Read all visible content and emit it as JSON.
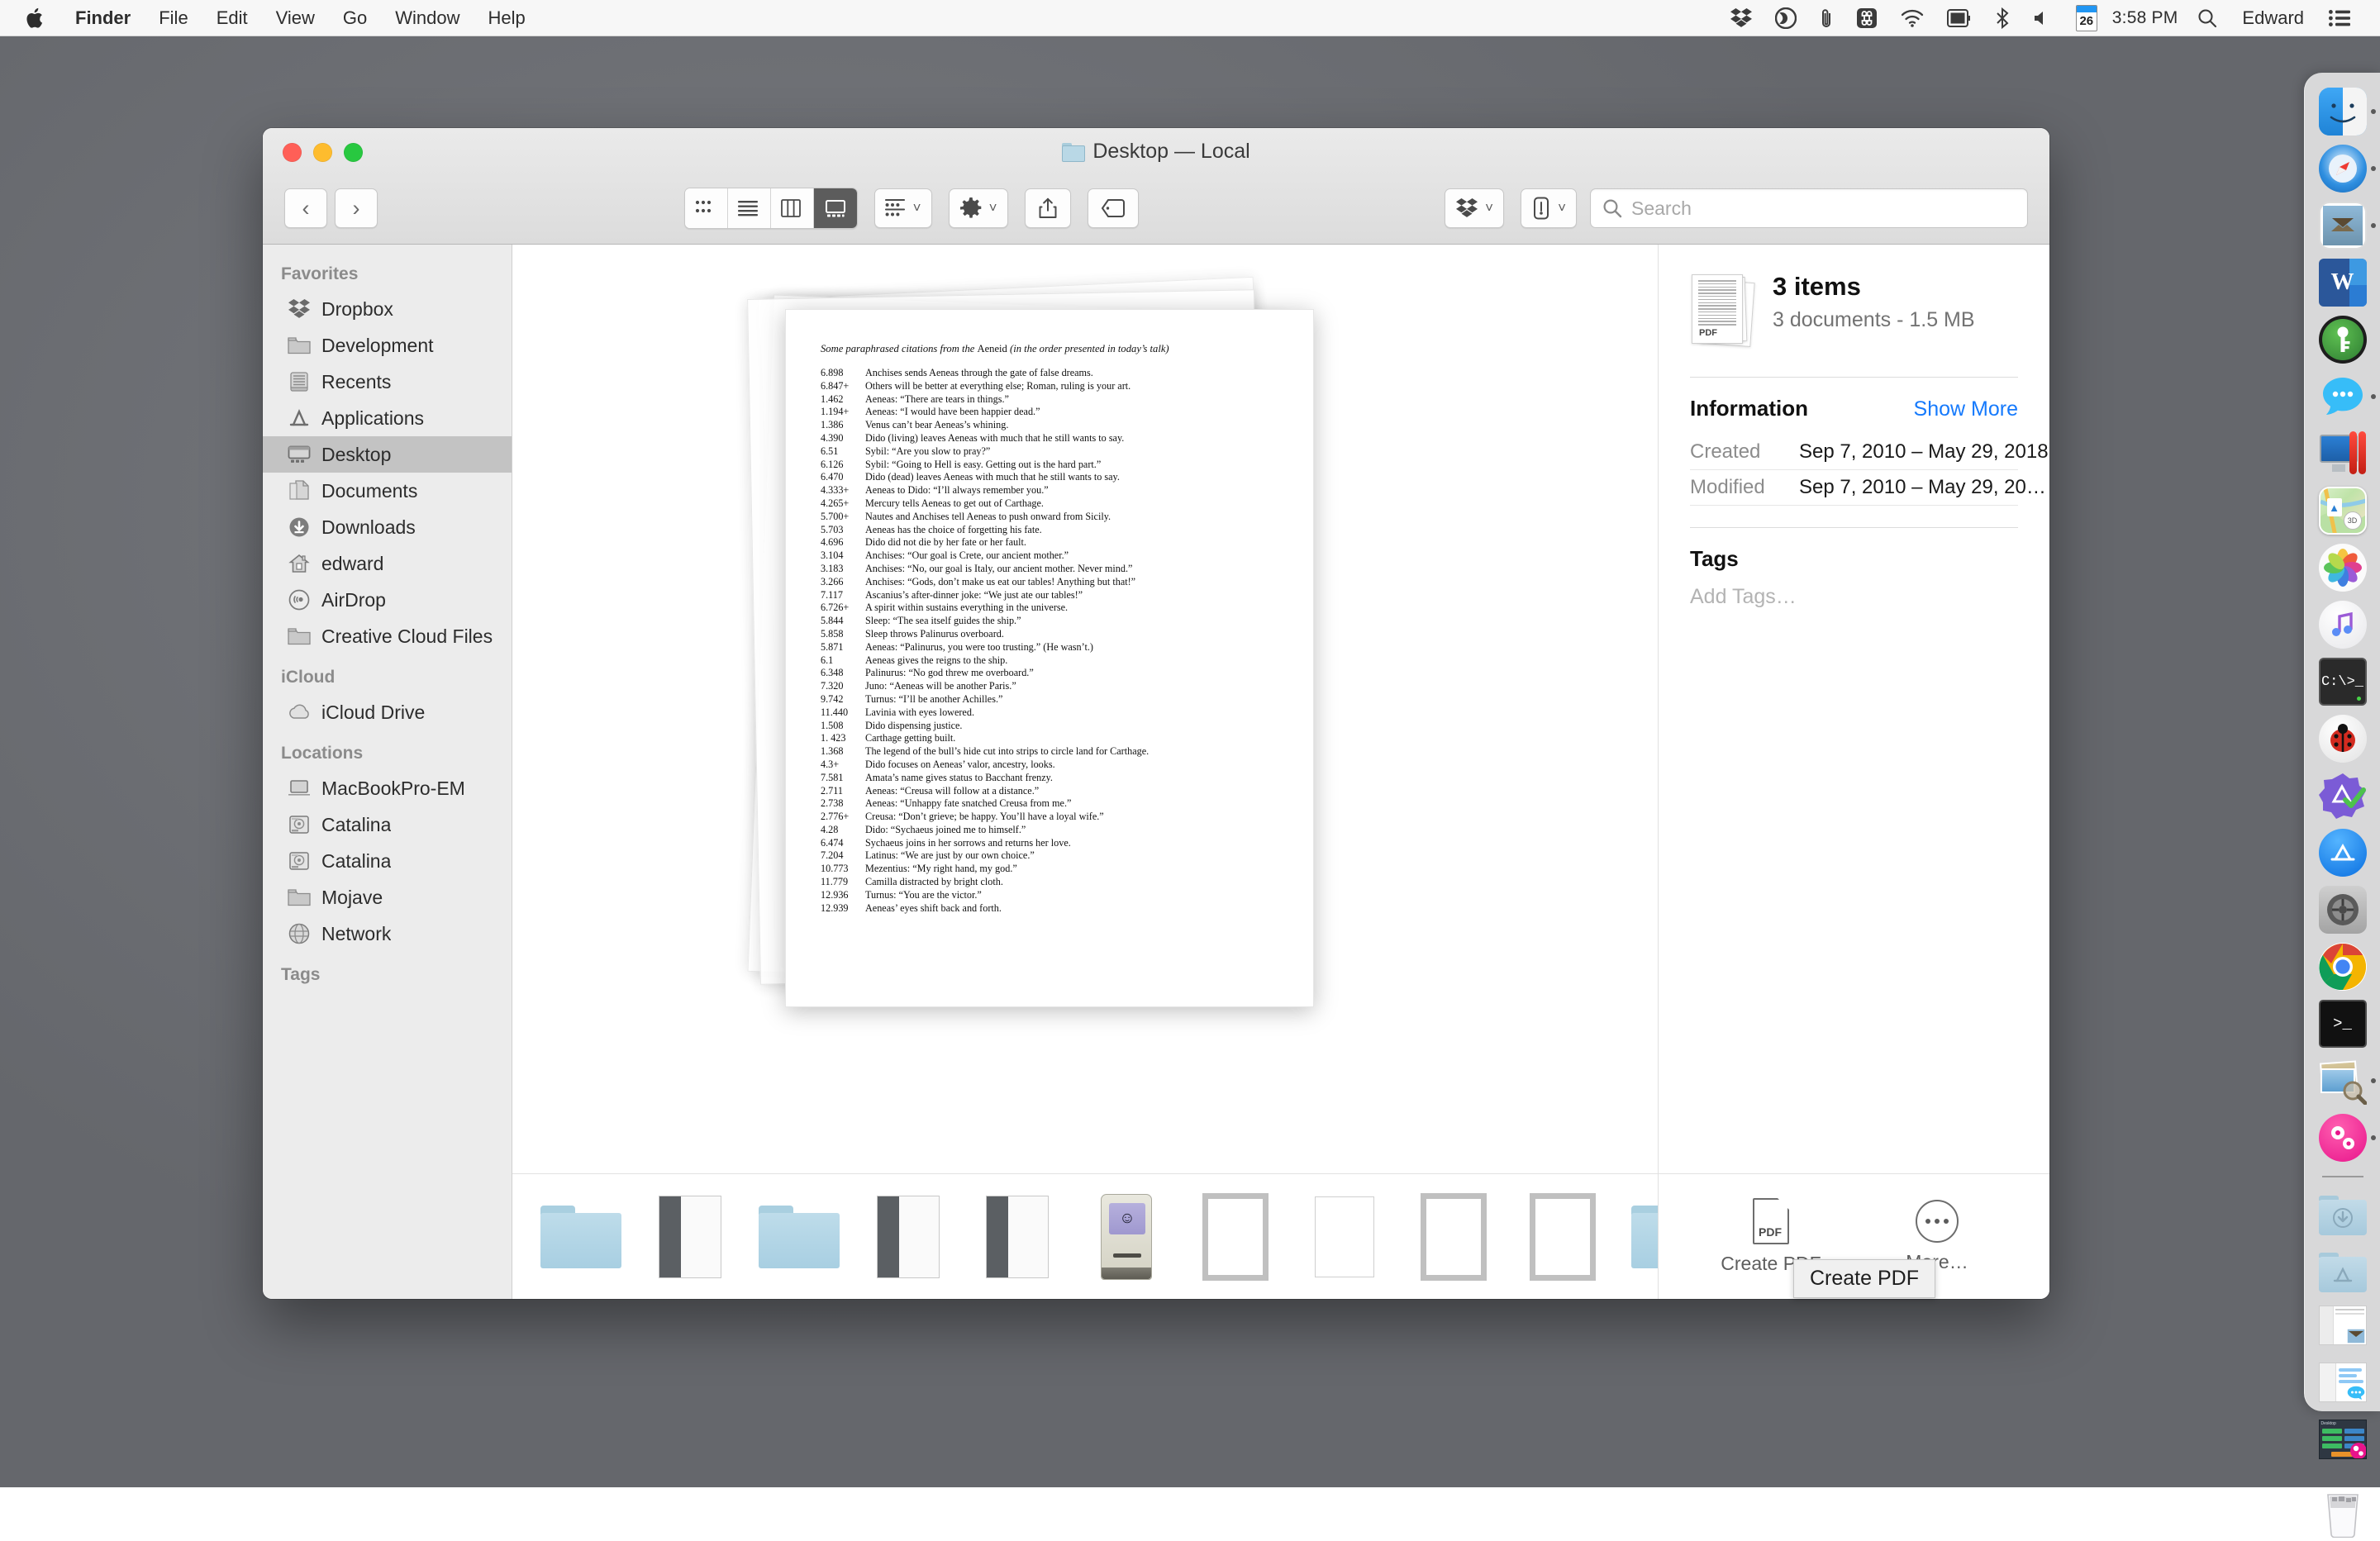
{
  "menubar": {
    "apple_icon": "apple-logo-icon",
    "items": [
      {
        "label": "Finder",
        "bold": true
      },
      {
        "label": "File",
        "bold": false
      },
      {
        "label": "Edit",
        "bold": false
      },
      {
        "label": "View",
        "bold": false
      },
      {
        "label": "Go",
        "bold": false
      },
      {
        "label": "Window",
        "bold": false
      },
      {
        "label": "Help",
        "bold": false
      }
    ],
    "status_icons": [
      "dropbox-icon",
      "creative-cloud-icon",
      "paperclip-icon",
      "command-key-icon",
      "wifi-icon",
      "display-icon",
      "bluetooth-icon",
      "volume-icon"
    ],
    "calendar_day": "26",
    "time": "3:58 PM",
    "search_icon": "spotlight-search-icon",
    "user": "Edward",
    "control_center_icon": "control-center-icon"
  },
  "window": {
    "title": "Desktop — Local",
    "title_icon": "folder-icon",
    "traffic_lights": [
      "close-button",
      "minimize-button",
      "zoom-button"
    ],
    "toolbar": {
      "back_label": "‹",
      "forward_label": "›",
      "view_modes": [
        "icon-view",
        "list-view",
        "column-view",
        "gallery-view"
      ],
      "active_view": "gallery-view",
      "group_by_label": "group-by-button",
      "action_label": "action-gear-button",
      "share_label": "share-button",
      "tags_label": "tags-button",
      "dropbox_label": "dropbox-button",
      "airdrop_label": "airdrop-button"
    },
    "search": {
      "placeholder": "Search",
      "value": ""
    }
  },
  "sidebar": {
    "sections": [
      {
        "header": "Favorites",
        "items": [
          {
            "label": "Dropbox",
            "icon": "dropbox-icon",
            "selected": false
          },
          {
            "label": "Development",
            "icon": "folder-icon",
            "selected": false
          },
          {
            "label": "Recents",
            "icon": "recents-clock-icon",
            "selected": false
          },
          {
            "label": "Applications",
            "icon": "applications-icon",
            "selected": false
          },
          {
            "label": "Desktop",
            "icon": "desktop-icon",
            "selected": true
          },
          {
            "label": "Documents",
            "icon": "documents-icon",
            "selected": false
          },
          {
            "label": "Downloads",
            "icon": "downloads-icon",
            "selected": false
          },
          {
            "label": "edward",
            "icon": "home-icon",
            "selected": false
          },
          {
            "label": "AirDrop",
            "icon": "airdrop-icon",
            "selected": false
          },
          {
            "label": "Creative Cloud Files",
            "icon": "folder-icon",
            "selected": false
          }
        ]
      },
      {
        "header": "iCloud",
        "items": [
          {
            "label": "iCloud Drive",
            "icon": "cloud-icon",
            "selected": false
          }
        ]
      },
      {
        "header": "Locations",
        "items": [
          {
            "label": "MacBookPro-EM",
            "icon": "laptop-icon",
            "selected": false
          },
          {
            "label": "Catalina",
            "icon": "harddisk-icon",
            "selected": false
          },
          {
            "label": "Catalina",
            "icon": "harddisk-icon",
            "selected": false
          },
          {
            "label": "Mojave",
            "icon": "folder-icon",
            "selected": false
          },
          {
            "label": "Network",
            "icon": "network-globe-icon",
            "selected": false
          }
        ]
      },
      {
        "header": "Tags",
        "items": []
      }
    ]
  },
  "preview": {
    "document_title_italic": "Some paraphrased citations from the ",
    "document_title_roman": "Aeneid",
    "document_title_tail": " (in the order presented in today’s talk)",
    "citations": [
      {
        "ref": "6.898",
        "text": "Anchises sends Aeneas through the gate of false dreams."
      },
      {
        "ref": "6.847+",
        "text": "Others will be better at everything else; Roman, ruling is your art."
      },
      {
        "ref": "1.462",
        "text": "Aeneas: “There are tears in things.”"
      },
      {
        "ref": "1.194+",
        "text": "Aeneas: “I would have been happier dead.”"
      },
      {
        "ref": "1.386",
        "text": "Venus can’t bear Aeneas’s whining."
      },
      {
        "ref": "4.390",
        "text": "Dido (living) leaves Aeneas with much that he still wants to say."
      },
      {
        "ref": "6.51",
        "text": "Sybil: “Are you slow to pray?”"
      },
      {
        "ref": "6.126",
        "text": "Sybil: “Going to Hell is easy. Getting out is the hard part.”"
      },
      {
        "ref": "6.470",
        "text": "Dido (dead) leaves Aeneas with much that he still wants to say."
      },
      {
        "ref": "4.333+",
        "text": "Aeneas to Dido: “I’ll always remember you.”"
      },
      {
        "ref": "4.265+",
        "text": "Mercury tells Aeneas to get out of Carthage."
      },
      {
        "ref": "5.700+",
        "text": "Nautes and Anchises tell Aeneas to push onward from Sicily."
      },
      {
        "ref": "5.703",
        "text": "Aeneas has the choice of forgetting his fate."
      },
      {
        "ref": "4.696",
        "text": "Dido did not die by her fate or her fault."
      },
      {
        "ref": "3.104",
        "text": "Anchises: “Our goal is Crete, our ancient mother.”"
      },
      {
        "ref": "3.183",
        "text": "Anchises: “No, our goal is Italy, our ancient mother. Never mind.”"
      },
      {
        "ref": "3.266",
        "text": "Anchises: “Gods, don’t make us eat our tables! Anything but that!”"
      },
      {
        "ref": "7.117",
        "text": "Ascanius’s after-dinner joke: “We just ate our tables!”"
      },
      {
        "ref": "6.726+",
        "text": "A spirit within sustains everything in the universe."
      },
      {
        "ref": "5.844",
        "text": "Sleep: “The sea itself guides the ship.”"
      },
      {
        "ref": "5.858",
        "text": "Sleep throws Palinurus overboard."
      },
      {
        "ref": "5.871",
        "text": "Aeneas: “Palinurus, you were too trusting.” (He wasn’t.)"
      },
      {
        "ref": "6.1",
        "text": "Aeneas gives the reigns to the ship."
      },
      {
        "ref": "6.348",
        "text": "Palinurus: “No god threw me overboard.”"
      },
      {
        "ref": "7.320",
        "text": "Juno: “Aeneas will be another Paris.”"
      },
      {
        "ref": "9.742",
        "text": "Turnus: “I’ll be another Achilles.”"
      },
      {
        "ref": "11.440",
        "text": "Lavinia with eyes lowered."
      },
      {
        "ref": "1.508",
        "text": "Dido dispensing justice."
      },
      {
        "ref": "1. 423",
        "text": "Carthage getting built."
      },
      {
        "ref": "1.368",
        "text": "The legend of the bull’s hide cut into strips to circle land for Carthage."
      },
      {
        "ref": "4.3+",
        "text": "Dido focuses on Aeneas’ valor, ancestry, looks."
      },
      {
        "ref": "7.581",
        "text": "Amata’s name gives status to Bacchant frenzy."
      },
      {
        "ref": "2.711",
        "text": "Aeneas: “Creusa will follow at a distance.”"
      },
      {
        "ref": "2.738",
        "text": "Aeneas: “Unhappy fate snatched Creusa from me.”"
      },
      {
        "ref": "2.776+",
        "text": "Creusa: “Don’t grieve; be happy. You’ll have a loyal wife.”"
      },
      {
        "ref": "4.28",
        "text": "Dido: “Sychaeus joined me to himself.”"
      },
      {
        "ref": "6.474",
        "text": "Sychaeus joins in her sorrows and returns her love."
      },
      {
        "ref": "7.204",
        "text": "Latinus: “We are just by our own choice.”"
      },
      {
        "ref": "10.773",
        "text": "Mezentius: “My right hand, my god.”"
      },
      {
        "ref": "11.779",
        "text": "Camilla distracted by bright cloth."
      },
      {
        "ref": "12.936",
        "text": "Turnus: “You are the victor.”"
      },
      {
        "ref": "12.939",
        "text": "Aeneas’ eyes shift back and forth."
      }
    ]
  },
  "filmstrip": {
    "thumbnails": [
      {
        "kind": "folder",
        "name": "thumbnail-folder"
      },
      {
        "kind": "window",
        "name": "thumbnail-screenshot-dark"
      },
      {
        "kind": "folder",
        "name": "thumbnail-folder"
      },
      {
        "kind": "window",
        "name": "thumbnail-screenshot-app"
      },
      {
        "kind": "window",
        "name": "thumbnail-screenshot-light"
      },
      {
        "kind": "mac",
        "name": "thumbnail-classic-mac"
      },
      {
        "kind": "docf",
        "name": "thumbnail-pdf-framed"
      },
      {
        "kind": "doc",
        "name": "thumbnail-pdf"
      },
      {
        "kind": "docf",
        "name": "thumbnail-pdf-framed"
      },
      {
        "kind": "docf",
        "name": "thumbnail-pdf-framed"
      },
      {
        "kind": "folder",
        "name": "thumbnail-folder"
      }
    ]
  },
  "inspector": {
    "icon": "pdf-documents-stack-icon",
    "title": "3 items",
    "subtitle": "3 documents - 1.5 MB",
    "section_information": "Information",
    "show_more": "Show More",
    "rows": [
      {
        "key": "Created",
        "value": "Sep 7, 2010 – May 29, 2018"
      },
      {
        "key": "Modified",
        "value": "Sep 7, 2010 – May 29, 20…"
      }
    ],
    "section_tags": "Tags",
    "tags_placeholder": "Add Tags…",
    "actions": [
      {
        "label": "Create PDF",
        "icon": "pdf-create-icon"
      },
      {
        "label": "More…",
        "icon": "more-dots-icon"
      }
    ],
    "tooltip": "Create PDF"
  },
  "dock": {
    "items": [
      {
        "name": "finder-icon",
        "running": true
      },
      {
        "name": "safari-icon",
        "running": true
      },
      {
        "name": "mail-icon",
        "running": true
      },
      {
        "name": "microsoft-word-icon",
        "running": false
      },
      {
        "name": "keepassxc-icon",
        "running": false
      },
      {
        "name": "messages-icon",
        "running": true
      },
      {
        "name": "parallels-desktop-icon",
        "running": false
      },
      {
        "name": "maps-icon",
        "running": false
      },
      {
        "name": "photos-icon",
        "running": false
      },
      {
        "name": "itunes-icon",
        "running": false
      },
      {
        "name": "windows-terminal-icon",
        "running": false
      },
      {
        "name": "ladybug-debug-icon",
        "running": false
      },
      {
        "name": "app-checker-icon",
        "running": false
      },
      {
        "name": "app-store-icon",
        "running": false
      },
      {
        "name": "system-preferences-icon",
        "running": false
      },
      {
        "name": "google-chrome-icon",
        "running": false
      },
      {
        "name": "terminal-icon",
        "running": false
      },
      {
        "name": "preview-icon",
        "running": true
      },
      {
        "name": "pink-gears-icon",
        "running": true
      },
      {
        "name": "separator",
        "running": false
      },
      {
        "name": "downloads-folder-icon",
        "running": false
      },
      {
        "name": "applications-folder-icon",
        "running": false
      },
      {
        "name": "minimized-mail-window-icon",
        "running": false
      },
      {
        "name": "minimized-messages-window-icon",
        "running": false
      },
      {
        "name": "minimized-app-window-icon",
        "running": false
      },
      {
        "name": "trash-icon",
        "running": false
      }
    ]
  },
  "colors": {
    "accent_blue": "#167afc",
    "selection_gray": "#c3c3c3",
    "desktop_gray": "#6f7176",
    "menubar_bg": "#f7f7f7"
  }
}
